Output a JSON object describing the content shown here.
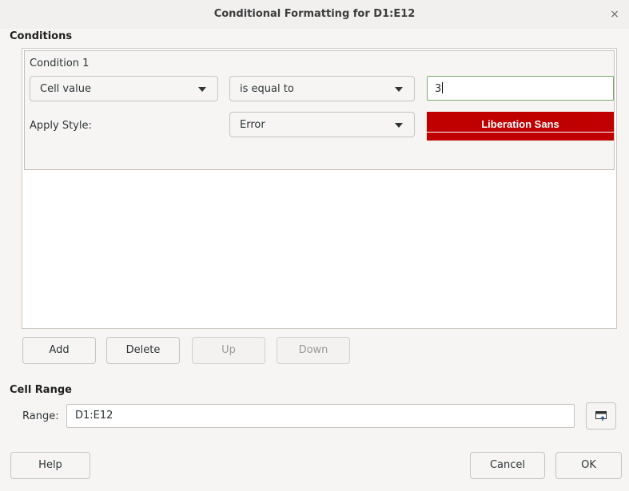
{
  "window": {
    "title": "Conditional Formatting for D1:E12",
    "close_glyph": "×"
  },
  "conditions": {
    "heading": "Conditions",
    "entries": [
      {
        "label": "Condition 1",
        "type": "Cell value",
        "operator": "is equal to",
        "value": "3",
        "apply_style_label": "Apply Style:",
        "style": "Error",
        "preview_text": "Liberation Sans",
        "preview_color": "#c00000"
      }
    ]
  },
  "buttons": {
    "add": "Add",
    "delete": "Delete",
    "up": "Up",
    "down": "Down",
    "help": "Help",
    "cancel": "Cancel",
    "ok": "OK"
  },
  "cell_range": {
    "heading": "Cell Range",
    "label": "Range:",
    "value": "D1:E12",
    "shrink_icon": "shrink-icon"
  }
}
